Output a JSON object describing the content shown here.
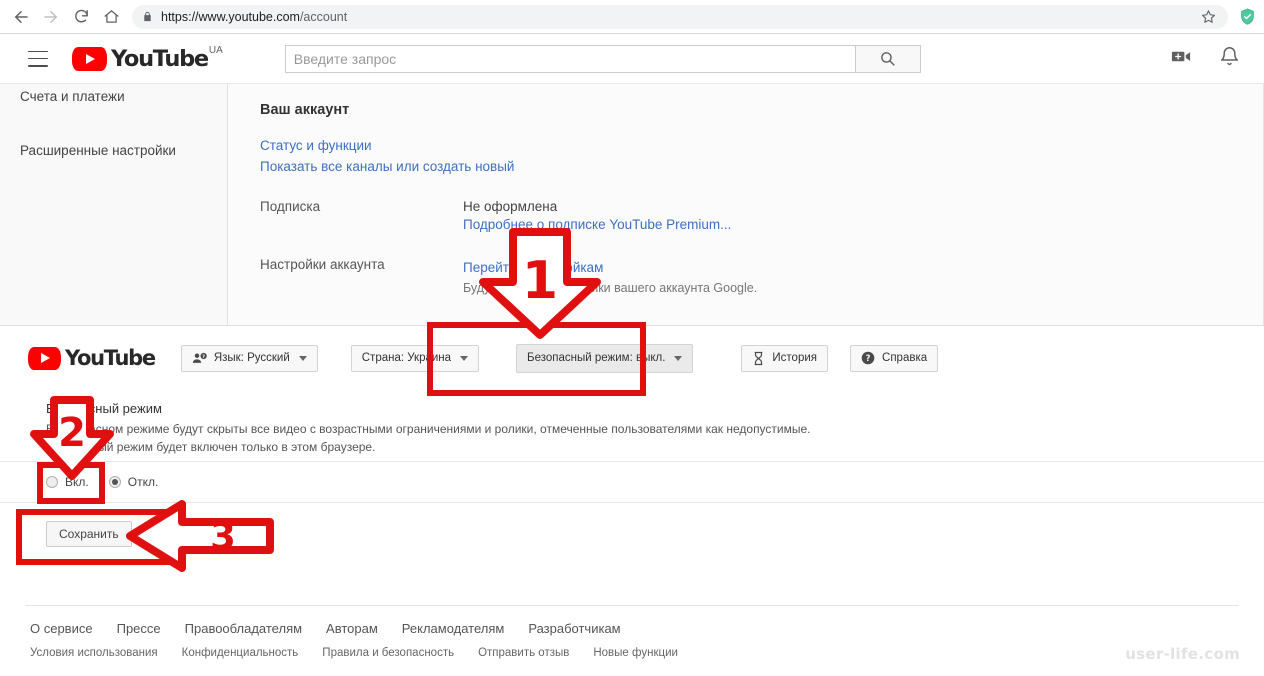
{
  "browser": {
    "url_domain": "https://www.youtube.com",
    "url_path": "/account",
    "back_icon": "back-arrow-icon",
    "forward_icon": "forward-arrow-icon",
    "reload_icon": "reload-icon",
    "home_icon": "home-icon",
    "lock_icon": "lock-icon",
    "star_icon": "bookmark-star-icon",
    "extension_icon": "shield-extension-icon",
    "extension_color": "#4ec9a0"
  },
  "masthead": {
    "menu_icon": "hamburger-menu-icon",
    "logo_text": "YouTube",
    "logo_country": "UA",
    "search_placeholder": "Введите запрос",
    "search_value": "",
    "search_icon": "search-icon",
    "create_video_icon": "video-camera-add-icon",
    "notifications_icon": "bell-icon"
  },
  "sidebar": {
    "items": [
      {
        "label": "Счета и платежи"
      },
      {
        "label": "Расширенные настройки"
      }
    ]
  },
  "account": {
    "title": "Ваш аккаунт",
    "links": [
      {
        "label": "Статус и функции"
      },
      {
        "label": "Показать все каналы или создать новый"
      }
    ],
    "rows": [
      {
        "label": "Подписка",
        "value": "Не оформлена",
        "link": "Подробнее о подписке YouTube Premium...",
        "sub": ""
      },
      {
        "label": "Настройки аккаунта",
        "value": "",
        "link": "Перейти к настройкам",
        "sub": "Будут открыты настройки вашего аккаунта Google."
      }
    ]
  },
  "safety_bar": {
    "logo_text": "YouTube",
    "language_button": {
      "label": "Язык: Русский",
      "icon": "person-question-icon"
    },
    "country_button": {
      "label": "Страна: Украина",
      "icon": ""
    },
    "safe_mode_button": {
      "label": "Безопасный режим: выкл.",
      "icon": ""
    },
    "history_button": {
      "label": "История",
      "icon": "hourglass-icon"
    },
    "help_button": {
      "label": "Справка",
      "icon": "question-circle-icon"
    }
  },
  "safe_mode": {
    "heading": "Безопасный режим",
    "description_line1": "В безопасном режиме будут скрыты все видео с возрастными ограничениями и ролики, отмеченные пользователями как недопустимые.",
    "description_line2": "Безопасный режим будет включен только в этом браузере.",
    "radio_on": "Вкл.",
    "radio_off": "Откл.",
    "selected": "off",
    "save_label": "Сохранить"
  },
  "footer": {
    "row1": [
      "О сервисе",
      "Прессе",
      "Правообладателям",
      "Авторам",
      "Рекламодателям",
      "Разработчикам"
    ],
    "row2": [
      "Условия использования",
      "Конфиденциальность",
      "Правила и безопасность",
      "Отправить отзыв",
      "Новые функции"
    ],
    "watermark": "user-life.com"
  },
  "annotations": {
    "color": "#e01010",
    "step1": "1",
    "step2": "2",
    "step3": "3"
  }
}
